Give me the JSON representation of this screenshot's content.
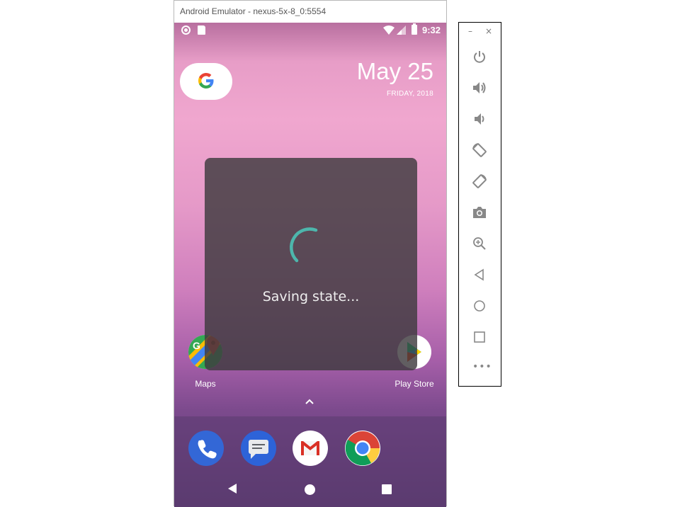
{
  "window": {
    "title": "Android Emulator - nexus-5x-8_0:5554"
  },
  "status_bar": {
    "time": "9:32"
  },
  "date_widget": {
    "date": "May 25",
    "day_year": "FRIDAY, 2018"
  },
  "home_apps": [
    {
      "label": "Maps"
    },
    {
      "label": "Play Store"
    }
  ],
  "overlay": {
    "message": "Saving state..."
  },
  "toolbar": {
    "minimize": "–",
    "close": "×",
    "more": "•••"
  },
  "colors": {
    "spinner": "#4db6ac",
    "overlay": "#3e3a3e",
    "wallpaper_top": "#f0a7cf",
    "wallpaper_bottom": "#5d3c70",
    "toolbar_icons": "#888888"
  }
}
